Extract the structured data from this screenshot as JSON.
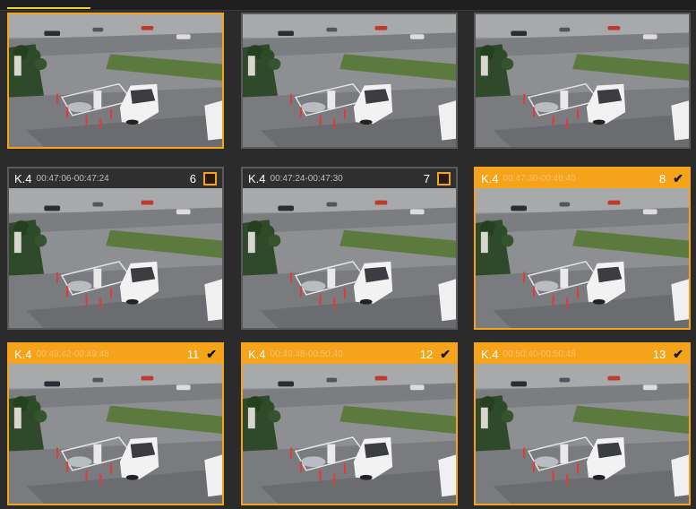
{
  "progress_value": 0.12,
  "colors": {
    "accent": "#f5a31a",
    "background": "#2b2b2b",
    "header_unselected": "#2f2f2f"
  },
  "tiles": [
    {
      "camera": "",
      "time": "",
      "number": "",
      "selected": true,
      "checked": false
    },
    {
      "camera": "",
      "time": "",
      "number": "",
      "selected": false,
      "checked": false
    },
    {
      "camera": "",
      "time": "",
      "number": "",
      "selected": false,
      "checked": false
    },
    {
      "camera": "K.4",
      "time": "00:47:06-00:47:24",
      "number": "6",
      "selected": false,
      "checked": false
    },
    {
      "camera": "K.4",
      "time": "00:47:24-00:47:30",
      "number": "7",
      "selected": false,
      "checked": false
    },
    {
      "camera": "K.4",
      "time": "00:47:30-00:48:40",
      "number": "8",
      "selected": true,
      "checked": true
    },
    {
      "camera": "K.4",
      "time": "00:49:42-00:49:48",
      "number": "11",
      "selected": true,
      "checked": true
    },
    {
      "camera": "K.4",
      "time": "00:49:48-00:50:40",
      "number": "12",
      "selected": true,
      "checked": true
    },
    {
      "camera": "K.4",
      "time": "00:50:40-00:50:48",
      "number": "13",
      "selected": true,
      "checked": true
    }
  ]
}
